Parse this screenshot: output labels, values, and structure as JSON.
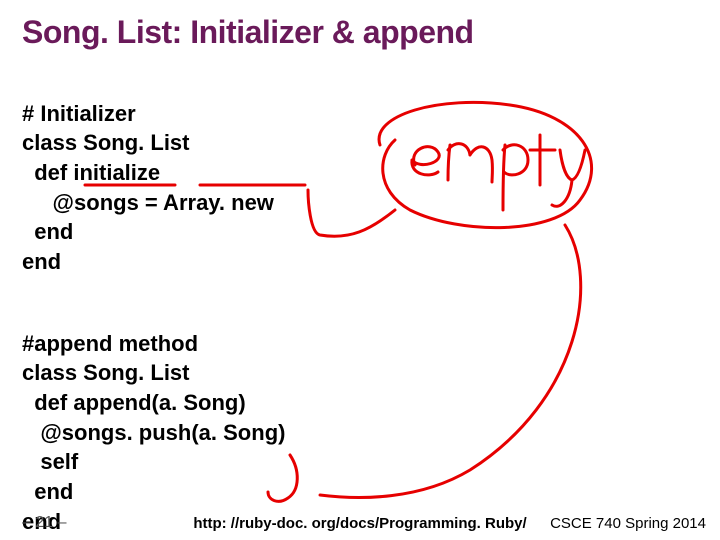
{
  "title": "Song. List: Initializer & append",
  "code1_l1": "# Initializer",
  "code1_l2": "class Song. List",
  "code1_l3": "  def initialize",
  "code1_l4": "     @songs = Array. new",
  "code1_l5": "  end",
  "code1_l6": "end",
  "code2_l1": "#append method",
  "code2_l2": "class Song. List",
  "code2_l3": "  def append(a. Song)",
  "code2_l4": "   @songs. push(a. Song)",
  "code2_l5": "   self",
  "code2_l6": "  end",
  "code2_l7": "end",
  "footer_page": "– 21 –",
  "footer_url": "http: //ruby-doc. org/docs/Programming. Ruby/",
  "footer_course": "CSCE 740 Spring 2014",
  "annotation_word": "empty"
}
